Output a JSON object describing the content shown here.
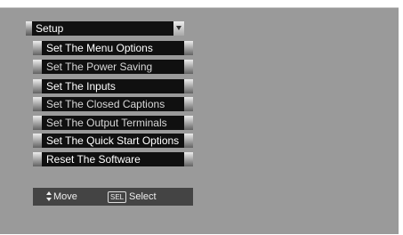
{
  "menu": {
    "title": "Setup",
    "items": [
      {
        "label": "Set The Menu Options"
      },
      {
        "label": "Set The Power Saving"
      },
      {
        "label": "Set The Inputs"
      },
      {
        "label": "Set The Closed Captions"
      },
      {
        "label": "Set  The Output Terminals"
      },
      {
        "label": "Set The Quick Start Options"
      },
      {
        "label": "Reset The Software"
      }
    ]
  },
  "footer": {
    "move_label": "Move",
    "sel_key": "SEL",
    "select_label": "Select"
  },
  "colors": {
    "screen_bg": "#9a9a9a",
    "item_bg": "#101010",
    "footer_bg": "#444444"
  }
}
